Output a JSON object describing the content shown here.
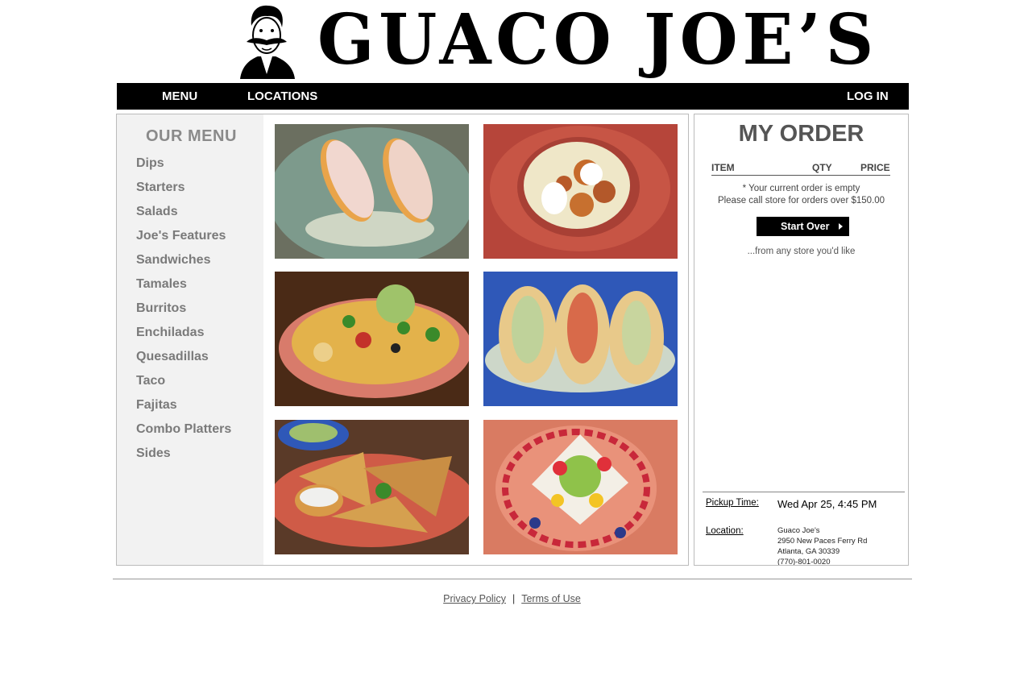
{
  "brand": {
    "name": "GUACO JOE’S"
  },
  "nav": {
    "menu": "MENU",
    "locations": "LOCATIONS",
    "login": "LOG IN"
  },
  "menu": {
    "title": "OUR MENU",
    "categories": [
      "Dips",
      "Starters",
      "Salads",
      "Joe's Features",
      "Sandwiches",
      "Tamales",
      "Burritos",
      "Enchiladas",
      "Quesadillas",
      "Taco",
      "Fajitas",
      "Combo Platters",
      "Sides"
    ]
  },
  "photos": [
    {
      "name": "elote-corn-photo"
    },
    {
      "name": "queso-dip-photo"
    },
    {
      "name": "nachos-photo"
    },
    {
      "name": "tacos-photo"
    },
    {
      "name": "quesadilla-photo"
    },
    {
      "name": "dessert-photo"
    }
  ],
  "order": {
    "title": "MY ORDER",
    "col_item": "ITEM",
    "col_qty": "QTY",
    "col_price": "PRICE",
    "empty_msg": "* Your current order is empty",
    "call_msg": "Please call store for orders over $150.00",
    "start_over": "Start Over",
    "any_store": "...from any store you'd like",
    "pickup_label": "Pickup Time:",
    "pickup_value": "Wed Apr 25, 4:45 PM",
    "location_label": "Location:",
    "location_name": "Guaco Joe's",
    "location_street": "2950 New Paces Ferry Rd",
    "location_city": "Atlanta, GA 30339",
    "location_phone": "(770)-801-0020"
  },
  "footer": {
    "privacy": "Privacy Policy",
    "separator": "|",
    "terms": "Terms of Use"
  },
  "colors": {
    "nav_bg": "#000000",
    "sidebar_bg": "#f2f2f2",
    "category_text": "#7a7a7a"
  }
}
